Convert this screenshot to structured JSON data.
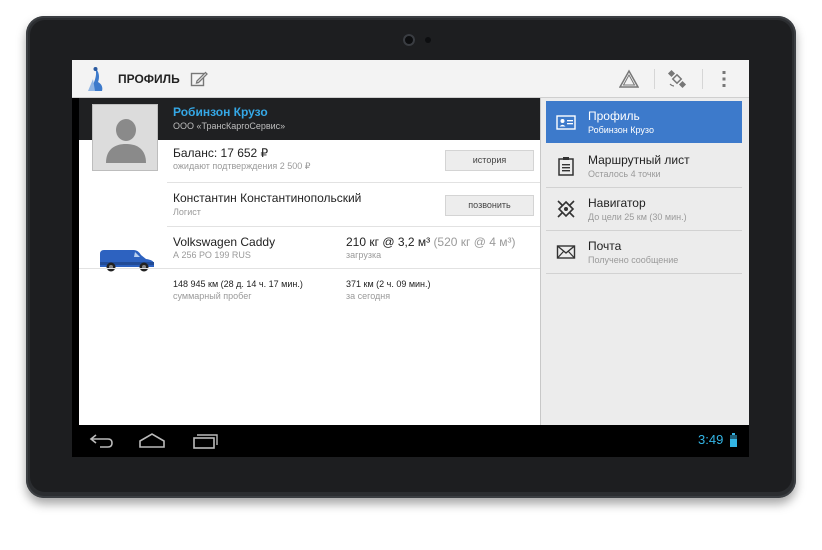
{
  "app": {
    "title": "ПРОФИЛЬ"
  },
  "profile": {
    "name": "Робинзон Крузо",
    "company": "ООО «ТрансКаргоСервис»",
    "balance": "Баланс: 17 652 ₽",
    "balance_pending": "ожидают подтверждения 2 500 ₽",
    "history_button": "история"
  },
  "logist": {
    "name": "Константин Константинопольский",
    "role": "Логист",
    "call_button": "позвонить"
  },
  "vehicle": {
    "model": "Volkswagen Caddy",
    "plate": "А 256 РО 199 RUS",
    "load_current": "210 кг @ 3,2 м³",
    "load_max": "(520 кг @ 4 м³)",
    "load_label": "загрузка"
  },
  "stats": {
    "total_mileage": "148 945 км (28 д. 14 ч. 17 мин.)",
    "total_mileage_label": "суммарный пробег",
    "today": "371 км (2 ч. 09 мин.)",
    "today_label": "за сегодня"
  },
  "nav": {
    "items": [
      {
        "label": "Профиль",
        "sub": "Робинзон Крузо",
        "icon": "profile-card-icon",
        "active": true
      },
      {
        "label": "Маршрутный лист",
        "sub": "Осталось 4 точки",
        "icon": "clipboard-icon",
        "active": false
      },
      {
        "label": "Навигатор",
        "sub": "До цели 25 км (30 мин.)",
        "icon": "gps-target-icon",
        "active": false
      },
      {
        "label": "Почта",
        "sub": "Получено сообщение",
        "icon": "envelope-icon",
        "active": false
      }
    ]
  },
  "system": {
    "time": "3:49"
  },
  "colors": {
    "accent": "#3d7acb",
    "link": "#35a8e6",
    "clock": "#33b5e5"
  }
}
